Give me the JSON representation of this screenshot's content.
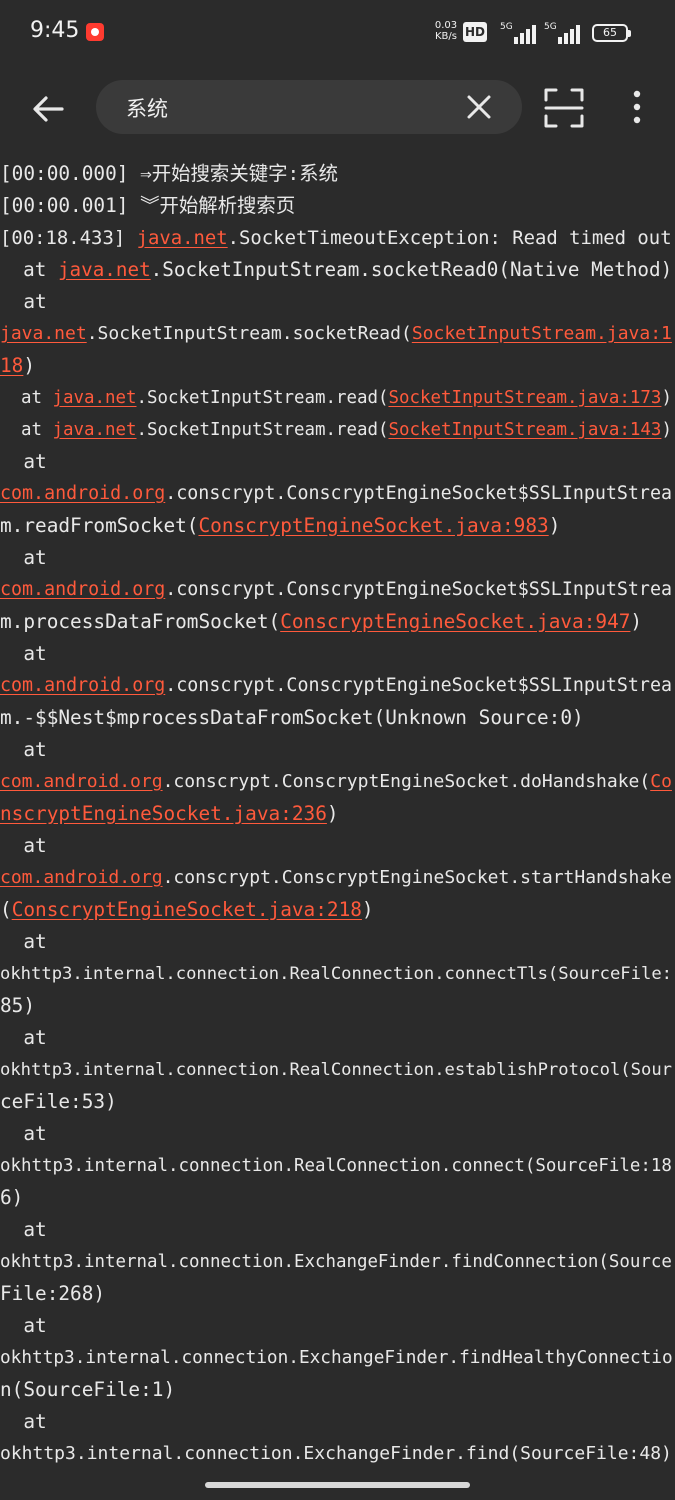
{
  "status_bar": {
    "time": "9:45",
    "net_speed_value": "0.03",
    "net_speed_unit": "KB/s",
    "hd_badge": "HD",
    "signal1_label": "5G",
    "signal2_label": "5G",
    "battery": "65"
  },
  "search": {
    "query": "系统"
  },
  "icons": {
    "back": "arrow-left-icon",
    "clear": "close-icon",
    "scan": "scan-icon",
    "more": "more-vertical-icon"
  },
  "colors": {
    "background": "#2b2b2b",
    "text": "#e8e8e8",
    "link": "#ff5a3c",
    "search_box": "#3a3a3a"
  },
  "log": {
    "lines": [
      [
        {
          "t": "[00:00.000] ⇒开始搜索关键字:系统"
        }
      ],
      [
        {
          "t": "[00:00.001] ︾开始解析搜索页"
        }
      ],
      [
        {
          "t": "[00:18.433] "
        },
        {
          "t": "java.net",
          "link": true
        },
        {
          "t": ".SocketTimeoutException: Read timed out"
        }
      ],
      [
        {
          "t": "  at "
        },
        {
          "t": "java.net",
          "link": true
        },
        {
          "t": ".SocketInputStream.socketRead0(Native Method)"
        }
      ],
      [
        {
          "t": "  at"
        }
      ],
      [
        {
          "t": "java.net",
          "link": true
        },
        {
          "t": ".SocketInputStream.socketRead("
        },
        {
          "t": "SocketInputStream.java:1",
          "link": true
        }
      ],
      [
        {
          "t": "18",
          "link": true
        },
        {
          "t": ")"
        }
      ],
      [
        {
          "t": "  at "
        },
        {
          "t": "java.net",
          "link": true
        },
        {
          "t": ".SocketInputStream.read("
        },
        {
          "t": "SocketInputStream.java:173",
          "link": true
        },
        {
          "t": ")"
        }
      ],
      [
        {
          "t": "  at "
        },
        {
          "t": "java.net",
          "link": true
        },
        {
          "t": ".SocketInputStream.read("
        },
        {
          "t": "SocketInputStream.java:143",
          "link": true
        },
        {
          "t": ")"
        }
      ],
      [
        {
          "t": "  at"
        }
      ],
      [
        {
          "t": "com.android.org",
          "link": true
        },
        {
          "t": ".conscrypt.ConscryptEngineSocket$SSLInputStrea"
        }
      ],
      [
        {
          "t": "m.readFromSocket("
        },
        {
          "t": "ConscryptEngineSocket.java:983",
          "link": true
        },
        {
          "t": ")"
        }
      ],
      [
        {
          "t": "  at"
        }
      ],
      [
        {
          "t": "com.android.org",
          "link": true
        },
        {
          "t": ".conscrypt.ConscryptEngineSocket$SSLInputStrea"
        }
      ],
      [
        {
          "t": "m.processDataFromSocket("
        },
        {
          "t": "ConscryptEngineSocket.java:947",
          "link": true
        },
        {
          "t": ")"
        }
      ],
      [
        {
          "t": "  at"
        }
      ],
      [
        {
          "t": "com.android.org",
          "link": true
        },
        {
          "t": ".conscrypt.ConscryptEngineSocket$SSLInputStrea"
        }
      ],
      [
        {
          "t": "m.-$$Nest$mprocessDataFromSocket(Unknown Source:0)"
        }
      ],
      [
        {
          "t": "  at"
        }
      ],
      [
        {
          "t": "com.android.org",
          "link": true
        },
        {
          "t": ".conscrypt.ConscryptEngineSocket.doHandshake("
        },
        {
          "t": "Co",
          "link": true
        }
      ],
      [
        {
          "t": "nscryptEngineSocket.java:236",
          "link": true
        },
        {
          "t": ")"
        }
      ],
      [
        {
          "t": "  at"
        }
      ],
      [
        {
          "t": "com.android.org",
          "link": true
        },
        {
          "t": ".conscrypt.ConscryptEngineSocket.startHandshake"
        }
      ],
      [
        {
          "t": "("
        },
        {
          "t": "ConscryptEngineSocket.java:218",
          "link": true
        },
        {
          "t": ")"
        }
      ],
      [
        {
          "t": "  at"
        }
      ],
      [
        {
          "t": "okhttp3.internal.connection.RealConnection.connectTls(SourceFile:"
        }
      ],
      [
        {
          "t": "85)"
        }
      ],
      [
        {
          "t": "  at"
        }
      ],
      [
        {
          "t": "okhttp3.internal.connection.RealConnection.establishProtocol(Sour"
        }
      ],
      [
        {
          "t": "ceFile:53)"
        }
      ],
      [
        {
          "t": "  at"
        }
      ],
      [
        {
          "t": "okhttp3.internal.connection.RealConnection.connect(SourceFile:18"
        }
      ],
      [
        {
          "t": "6)"
        }
      ],
      [
        {
          "t": "  at"
        }
      ],
      [
        {
          "t": "okhttp3.internal.connection.ExchangeFinder.findConnection(Source"
        }
      ],
      [
        {
          "t": "File:268)"
        }
      ],
      [
        {
          "t": "  at"
        }
      ],
      [
        {
          "t": "okhttp3.internal.connection.ExchangeFinder.findHealthyConnectio"
        }
      ],
      [
        {
          "t": "n(SourceFile:1)"
        }
      ],
      [
        {
          "t": "  at"
        }
      ],
      [
        {
          "t": "okhttp3.internal.connection.ExchangeFinder.find(SourceFile:48)"
        }
      ]
    ]
  }
}
